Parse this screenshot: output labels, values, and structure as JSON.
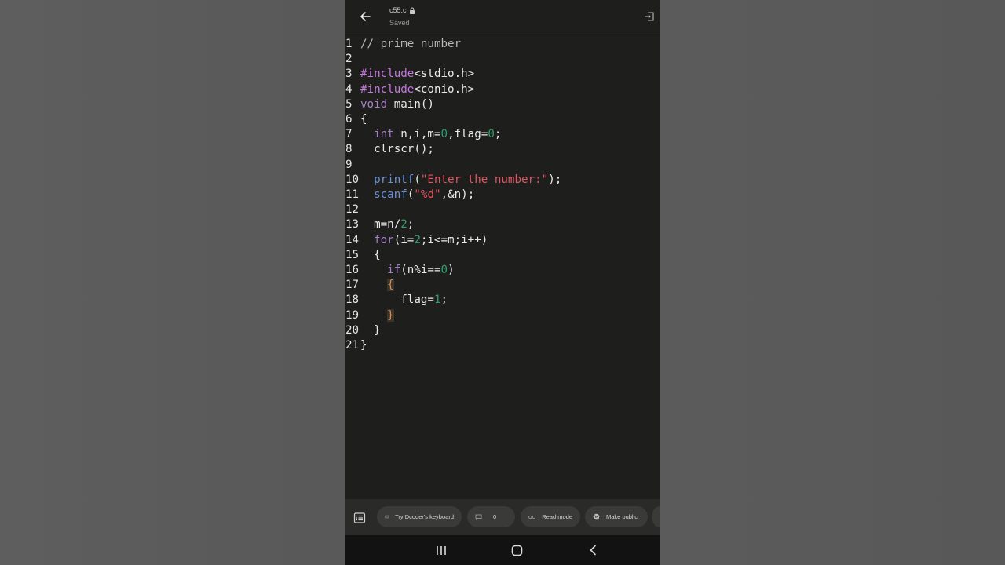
{
  "header": {
    "file_name": "c55.c",
    "status": "Saved"
  },
  "icons": {
    "back": "arrow-left-icon",
    "lock": "lock-icon",
    "exit": "exit-icon",
    "outline": "outline-list-icon",
    "keyboard": "keyboard-icon",
    "comment": "comment-icon",
    "read": "glasses-icon",
    "public": "globe-icon"
  },
  "code": {
    "lines": [
      {
        "num": "1",
        "tokens": [
          [
            "t-comment",
            "// prime number"
          ]
        ]
      },
      {
        "num": "2",
        "tokens": []
      },
      {
        "num": "3",
        "tokens": [
          [
            "t-pre",
            "#include"
          ],
          [
            "t-plain",
            "<stdio.h>"
          ]
        ]
      },
      {
        "num": "4",
        "tokens": [
          [
            "t-pre",
            "#include"
          ],
          [
            "t-plain",
            "<conio.h>"
          ]
        ]
      },
      {
        "num": "5",
        "tokens": [
          [
            "t-kw",
            "void"
          ],
          [
            "t-plain",
            " main()"
          ]
        ]
      },
      {
        "num": "6",
        "tokens": [
          [
            "t-plain",
            "{"
          ]
        ]
      },
      {
        "num": "7",
        "tokens": [
          [
            "t-plain",
            "  "
          ],
          [
            "t-kw",
            "int"
          ],
          [
            "t-plain",
            " n,i,m="
          ],
          [
            "t-num",
            "0"
          ],
          [
            "t-plain",
            ",flag="
          ],
          [
            "t-num",
            "0"
          ],
          [
            "t-plain",
            ";"
          ]
        ]
      },
      {
        "num": "8",
        "tokens": [
          [
            "t-plain",
            "  clrscr();"
          ]
        ]
      },
      {
        "num": "9",
        "tokens": []
      },
      {
        "num": "10",
        "tokens": [
          [
            "t-plain",
            "  "
          ],
          [
            "t-fn",
            "printf"
          ],
          [
            "t-plain",
            "("
          ],
          [
            "t-str",
            "\"Enter the number:\""
          ],
          [
            "t-plain",
            ");"
          ]
        ]
      },
      {
        "num": "11",
        "tokens": [
          [
            "t-plain",
            "  "
          ],
          [
            "t-fn",
            "scanf"
          ],
          [
            "t-plain",
            "("
          ],
          [
            "t-str",
            "\"%d\""
          ],
          [
            "t-plain",
            ",&n);"
          ]
        ]
      },
      {
        "num": "12",
        "tokens": []
      },
      {
        "num": "13",
        "tokens": [
          [
            "t-plain",
            "  m=n/"
          ],
          [
            "t-num",
            "2"
          ],
          [
            "t-plain",
            ";"
          ]
        ]
      },
      {
        "num": "14",
        "tokens": [
          [
            "t-plain",
            "  "
          ],
          [
            "t-kw",
            "for"
          ],
          [
            "t-plain",
            "(i="
          ],
          [
            "t-num",
            "2"
          ],
          [
            "t-plain",
            ";i<=m;i++)"
          ]
        ]
      },
      {
        "num": "15",
        "tokens": [
          [
            "t-plain",
            "  {"
          ]
        ]
      },
      {
        "num": "16",
        "tokens": [
          [
            "t-plain",
            "    "
          ],
          [
            "t-kw",
            "if"
          ],
          [
            "t-plain",
            "(n%i=="
          ],
          [
            "t-num",
            "0"
          ],
          [
            "t-plain",
            ")"
          ]
        ]
      },
      {
        "num": "17",
        "tokens": [
          [
            "t-plain",
            "    "
          ],
          [
            "t-brace-hl",
            "{"
          ]
        ]
      },
      {
        "num": "18",
        "tokens": [
          [
            "t-plain",
            "      flag="
          ],
          [
            "t-num",
            "1"
          ],
          [
            "t-plain",
            ";"
          ]
        ]
      },
      {
        "num": "19",
        "tokens": [
          [
            "t-plain",
            "    "
          ],
          [
            "t-brace-hl",
            "}"
          ]
        ]
      },
      {
        "num": "20",
        "tokens": [
          [
            "t-plain",
            "  }"
          ]
        ]
      },
      {
        "num": "21",
        "tokens": [
          [
            "t-plain",
            "}"
          ]
        ]
      }
    ]
  },
  "toolbar": {
    "keyboard_label": "Try Dcoder's keyboard",
    "comments_count": "0",
    "read_mode_label": "Read mode",
    "make_public_label": "Make public"
  },
  "colors": {
    "editor_bg": "#1e1f1c",
    "preprocessor": "#c678dd",
    "keyword": "#a57fc8",
    "function": "#6c8fd4",
    "string": "#e05561",
    "number": "#2f9e6a"
  }
}
